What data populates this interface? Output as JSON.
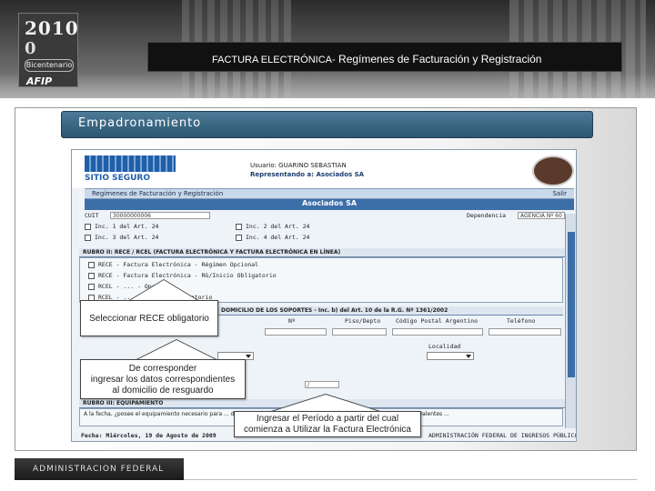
{
  "header": {
    "logo_year": "2010",
    "logo_zero": "0",
    "logo_bicentenario": "Bicentenario",
    "logo_afip": "AFIP",
    "title_part1": "FACTURA ELECTRÓNICA-",
    "title_part2": " Regímenes de Facturación y Registración"
  },
  "section": {
    "title": "Empadronamiento"
  },
  "form": {
    "logo_sub": "SITIO SEGURO",
    "user_line1": "Usuario: GUARINO SEBASTIAN",
    "user_line2": "Representando a: Asociados SA",
    "menu_left": "Regímenes de Facturación y Registración",
    "menu_right": "Salir",
    "company": "Asociados SA",
    "cuit_label": "CUIT",
    "cuit_value": "30000000006",
    "dep_label": "Dependencia",
    "dep_value": "AGENCIA Nº 60",
    "rows_a": [
      "Inc. 1 del Art. 24",
      "Inc. 2 del Art. 24",
      "Inc. 3 del Art. 24",
      "Inc. 4 del Art. 24"
    ],
    "section_rece": "RUBRO II: RECE / RCEL (FACTURA ELECTRÓNICA Y FACTURA ELECTRÓNICA EN LÍNEA)",
    "rows_b": [
      "RECE - Factura Electrónica - Régimen Opcional",
      "RECE - Factura Electrónica - RG/Inicio Obligatorio",
      "RCEL - ... - Opcional",
      "RCEL - ... - Régimen Obligatorio"
    ],
    "section_domicilio": "DOMICILIO DE LOS SOPORTES - Inc. b) del Art. 10 de la R.G. Nº 1361/2002",
    "domicilio_cols": [
      "Nº",
      "Piso/Depto",
      "Código Postal Argentino",
      "Teléfono"
    ],
    "localidad_label": "Localidad",
    "section_equip": "RUBRO III: EQUIPAMIENTO",
    "equip_text": "A la fecha, ¿posee el equipamiento necesario para ... de las facturas, notas de débito, notas de crédito o documentos equivalentes ...",
    "fecha_label": "Fecha: Miércoles, 19 de Agosto de 2009",
    "footer_text": "ADMINISTRACIÓN FEDERAL DE INGRESOS PÚBLICOS",
    "period_value": "/"
  },
  "callouts": {
    "c1": "Seleccionar RECE obligatorio",
    "c2_line1": "De corresponder",
    "c2_line2": "ingresar los datos correspondientes",
    "c2_line3": "al domicilio de resguardo",
    "c3_line1": "Ingresar el Período a partir del cual",
    "c3_line2": "comienza a Utilizar la Factura Electrónica"
  },
  "footer": {
    "label": "ADMINISTRACION FEDERAL"
  },
  "colors": {
    "section_bar": "#2a5672",
    "company_bar": "#3c6ea8",
    "title_bar": "#111111"
  }
}
